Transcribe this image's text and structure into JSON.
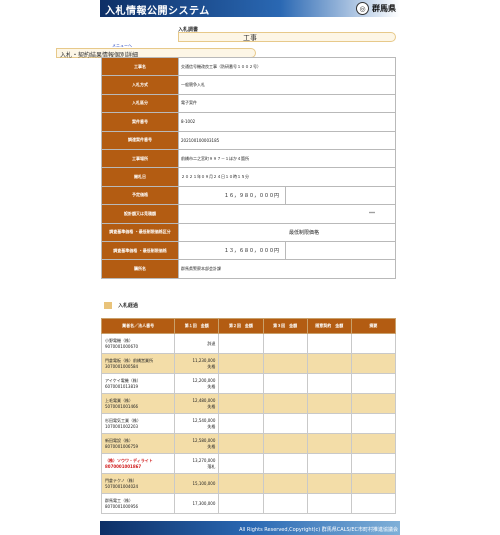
{
  "header": {
    "title": "入札情報公開システム",
    "prefecture": "群馬県",
    "emblem_icon": "prefecture-emblem-icon"
  },
  "category_band": {
    "label": "入札調書",
    "koji": "工事"
  },
  "menu_link": "メニューへ",
  "page_title": "入札・契約結果情報個別詳細",
  "detail": [
    {
      "label": "工事名",
      "value": "交通信号機改良工事（防研番号１００２号）"
    },
    {
      "label": "入札方式",
      "value": "一般競争入札"
    },
    {
      "label": "入札區分",
      "value": "電子案件"
    },
    {
      "label": "案件番号",
      "value": "8-1002"
    },
    {
      "label": "調達案件番号",
      "value": "202100100003185"
    },
    {
      "label": "工事場所",
      "value": "前橋市二之宮町９９７－１ほか４箇所"
    },
    {
      "label": "開札日",
      "value": "２０２１年０９月２４日１０時１５分"
    },
    {
      "label": "予定価格",
      "value": "１６，９８０，０００円"
    },
    {
      "label": "設計額又は見積額",
      "value": "***"
    },
    {
      "label": "調査基準価格 ・最低制限価格区分",
      "value": "最低制限価格"
    },
    {
      "label": "調査基準価格 ・最低制限価格",
      "value": "１３，６８０，０００円"
    },
    {
      "label": "購所名",
      "value": "群馬県警察本部会計課"
    }
  ],
  "section_title": "入札経過",
  "results": {
    "headers": [
      "業者名／法人番号",
      "第１回　金額",
      "第２回　金額",
      "第３回　金額",
      "随意契約　金額",
      "摘要"
    ],
    "rows": [
      {
        "name": "小野電機（株）",
        "corp": "9070001000670",
        "amount": "",
        "note": "辞退",
        "alt": false,
        "hl": false
      },
      {
        "name": "門倉電板（株）前橋営業所",
        "corp": "3070001000584",
        "amount": "11,230,000",
        "note": "失格",
        "alt": true,
        "hl": false
      },
      {
        "name": "アイケイ電機（株）",
        "corp": "6070001013819",
        "amount": "12,200,000",
        "note": "失格",
        "alt": false,
        "hl": false
      },
      {
        "name": "上毛電業（株）",
        "corp": "5070001001466",
        "amount": "12,480,000",
        "note": "失格",
        "alt": true,
        "hl": false
      },
      {
        "name": "杉田電気工業（株）",
        "corp": "1070001002203",
        "amount": "12,540,000",
        "note": "失格",
        "alt": false,
        "hl": false
      },
      {
        "name": "新田電設（株）",
        "corp": "8070001006759",
        "amount": "12,580,000",
        "note": "失格",
        "alt": true,
        "hl": false
      },
      {
        "name": "（株）ソウワ・ディライト",
        "corp": "8070001001867",
        "amount": "13,270,000",
        "note": "落札",
        "alt": false,
        "hl": true
      },
      {
        "name": "門倉テクノ（株）",
        "corp": "5070001004024",
        "amount": "15,100,000",
        "note": "",
        "alt": true,
        "hl": false
      },
      {
        "name": "群馬電工（株）",
        "corp": "8070001000956",
        "amount": "17,300,000",
        "note": "",
        "alt": false,
        "hl": false
      }
    ]
  },
  "footer": "All Rights Reserved,Copyright(c) 群馬県CALS/EC市町村推進協議会"
}
